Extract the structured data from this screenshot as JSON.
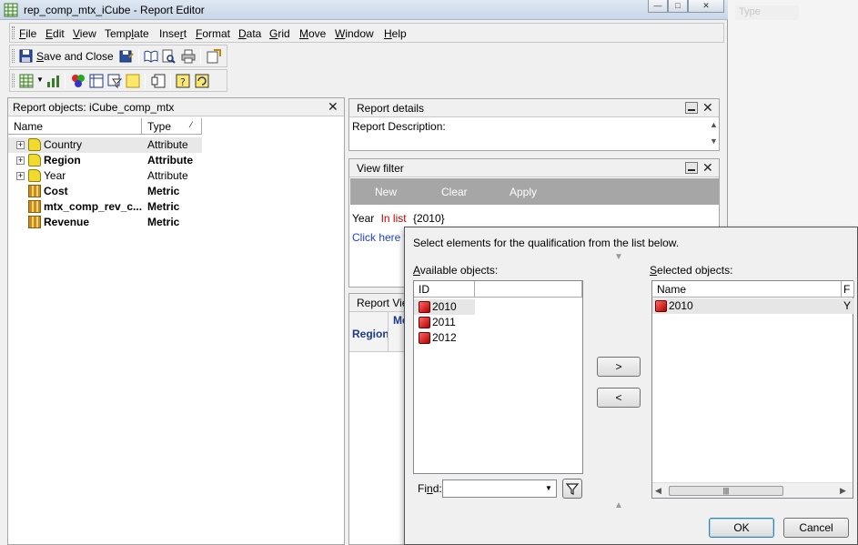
{
  "window": {
    "title": "rep_comp_mtx_iCube - Report Editor",
    "background_hint_1": "Name",
    "background_hint_2": "Type"
  },
  "menu": [
    {
      "label": "File",
      "u": "F",
      "rest": "ile"
    },
    {
      "label": "Edit",
      "u": "E",
      "rest": "dit"
    },
    {
      "label": "View",
      "u": "V",
      "rest": "iew"
    },
    {
      "label": "Template",
      "pre": "Temp",
      "u": "l",
      "rest": "ate"
    },
    {
      "label": "Insert",
      "pre": "Inse",
      "u": "r",
      "rest": "t"
    },
    {
      "label": "Format",
      "u": "F",
      "rest": "ormat"
    },
    {
      "label": "Data",
      "u": "D",
      "rest": "ata"
    },
    {
      "label": "Grid",
      "u": "G",
      "rest": "rid"
    },
    {
      "label": "Move",
      "u": "M",
      "rest": "ove"
    },
    {
      "label": "Window",
      "u": "W",
      "rest": "indow"
    },
    {
      "label": "Help",
      "u": "H",
      "rest": "elp"
    }
  ],
  "toolbar": {
    "save_close_label": "Save and Close",
    "save_close_u": "S",
    "save_close_rest": "ave and Close"
  },
  "report_objects": {
    "header": "Report objects: iCube_comp_mtx",
    "col_name": "Name",
    "col_type": "Type",
    "rows": [
      {
        "name": "Country",
        "type": "Attribute",
        "kind": "attribute",
        "bold": false
      },
      {
        "name": "Region",
        "type": "Attribute",
        "kind": "attribute",
        "bold": true
      },
      {
        "name": "Year",
        "type": "Attribute",
        "kind": "attribute",
        "bold": false
      },
      {
        "name": "Cost",
        "type": "Metric",
        "kind": "metric",
        "bold": true
      },
      {
        "name": "mtx_comp_rev_c...",
        "type": "Metric",
        "kind": "metric",
        "bold": true
      },
      {
        "name": "Revenue",
        "type": "Metric",
        "kind": "metric",
        "bold": true
      }
    ]
  },
  "report_details": {
    "header": "Report details",
    "description_label": "Report Description:"
  },
  "view_filter": {
    "header": "View filter",
    "buttons": {
      "new": "New",
      "clear": "Clear",
      "apply": "Apply"
    },
    "condition": {
      "attribute": "Year",
      "operator": "In list",
      "value": "{2010}"
    },
    "link_text": "Click here to"
  },
  "report_view": {
    "header": "Report View",
    "col1": "Region",
    "col2": "Me"
  },
  "dialog": {
    "instruction": "Select elements for the qualification from the list below.",
    "available_label": "Available objects:",
    "available_u": "A",
    "available_rest": "vailable objects:",
    "available_col": "ID",
    "available_items": [
      "2010",
      "2011",
      "2012"
    ],
    "selected_label": "Selected objects:",
    "selected_u": "S",
    "selected_rest": "elected objects:",
    "selected_col_name": "Name",
    "selected_col_2": "F",
    "selected_items": [
      {
        "name": "2010",
        "extra": "Y"
      }
    ],
    "add_button": ">",
    "remove_button": "<",
    "find_label": "Find:",
    "find_pre": "Fi",
    "find_u": "n",
    "find_rest": "d:",
    "find_value": "",
    "ok_label": "OK",
    "cancel_label": "Cancel"
  }
}
